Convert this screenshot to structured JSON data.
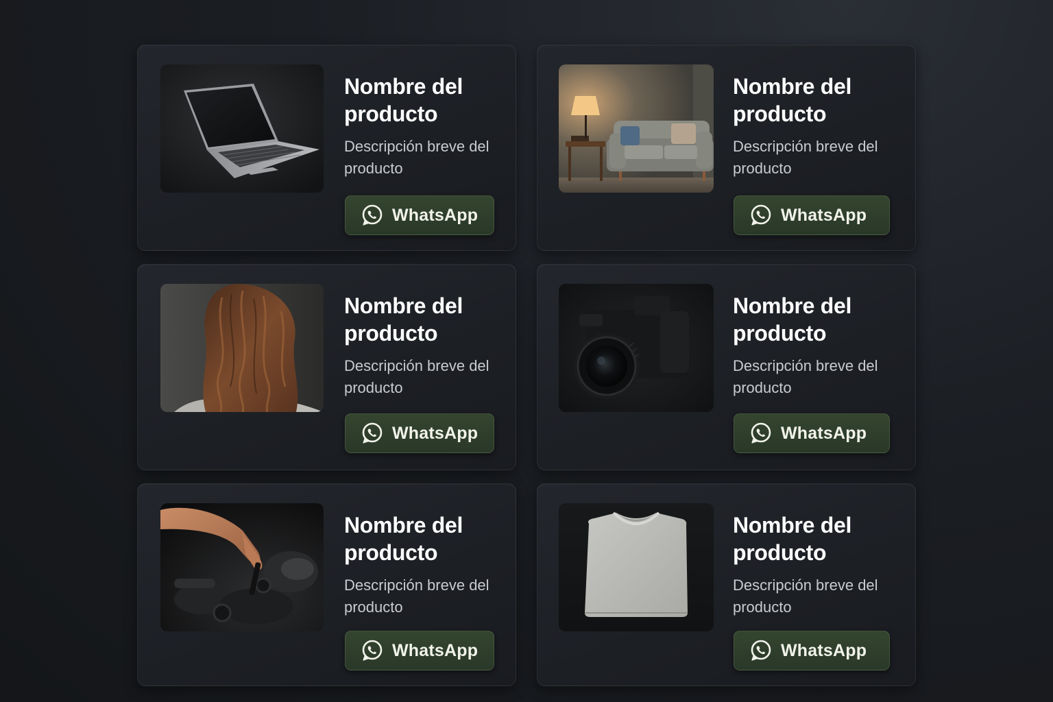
{
  "products": [
    {
      "name": "Nombre del producto",
      "description": "Descripción breve del producto",
      "image": "laptop",
      "button_label": "WhatsApp",
      "button_icon": "whatsapp-icon"
    },
    {
      "name": "Nombre del producto",
      "description": "Descripción breve del producto",
      "image": "sofa-with-lamp",
      "button_label": "WhatsApp",
      "button_icon": "whatsapp-icon"
    },
    {
      "name": "Nombre del producto",
      "description": "Descripción breve del producto",
      "image": "wavy-hair",
      "button_label": "WhatsApp",
      "button_icon": "whatsapp-icon"
    },
    {
      "name": "Nombre del producto",
      "description": "Descripción breve del producto",
      "image": "camera",
      "button_label": "WhatsApp",
      "button_icon": "whatsapp-icon"
    },
    {
      "name": "Nombre del producto",
      "description": "Descripción breve del producto",
      "image": "car-engine-repair",
      "button_label": "WhatsApp",
      "button_icon": "whatsapp-icon"
    },
    {
      "name": "Nombre del producto",
      "description": "Descripción breve del producto",
      "image": "folded-tshirt",
      "button_label": "WhatsApp",
      "button_icon": "whatsapp-icon"
    }
  ],
  "colors": {
    "background": "#17191d",
    "card": "#1f2227",
    "button": "#2f3f2c",
    "button_text": "#f1f3ea"
  }
}
